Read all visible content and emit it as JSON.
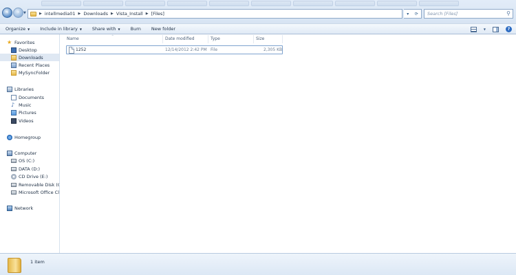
{
  "address_bar": {
    "crumbs": [
      "intellmedia01",
      "Downloads",
      "Vista_Install",
      "[Files]"
    ],
    "search_placeholder": "Search [Files]"
  },
  "command_bar": {
    "organize": "Organize",
    "include_in_library": "Include in library",
    "share_with": "Share with",
    "burn": "Burn",
    "new_folder": "New folder"
  },
  "nav_pane": {
    "favorites": {
      "label": "Favorites",
      "items": [
        "Desktop",
        "Downloads",
        "Recent Places",
        "MySyncFolder"
      ],
      "selected": "Downloads"
    },
    "libraries": {
      "label": "Libraries",
      "items": [
        "Documents",
        "Music",
        "Pictures",
        "Videos"
      ]
    },
    "homegroup": "Homegroup",
    "computer": {
      "label": "Computer",
      "items": [
        "OS (C:)",
        "DATA (D:)",
        "CD Drive (E:)",
        "Removable Disk (G:)",
        "Microsoft Office Clic"
      ]
    },
    "network": "Network"
  },
  "file_list": {
    "columns": [
      "Name",
      "Date modified",
      "Type",
      "Size"
    ],
    "rows": [
      {
        "name": "1252",
        "date_modified": "12/14/2012 2:42 PM",
        "type": "File",
        "size": "2,305 KB"
      }
    ]
  },
  "details_pane": {
    "item_count": "1 item"
  }
}
